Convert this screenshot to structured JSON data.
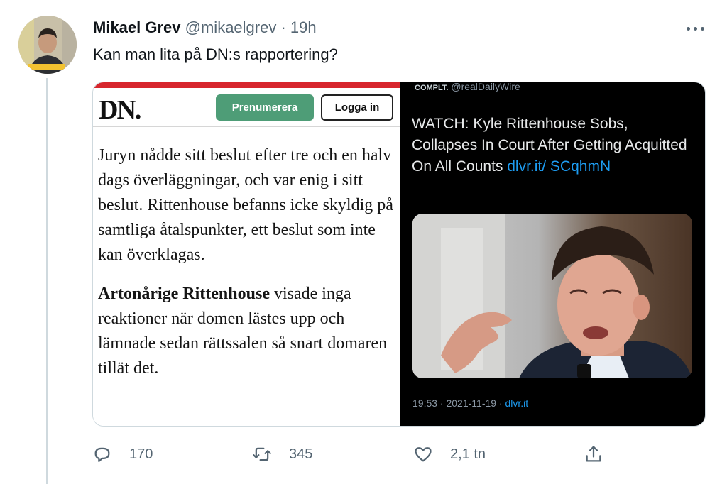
{
  "tweet": {
    "author_name": "Mikael Grev",
    "handle": "@mikaelgrev",
    "separator": "·",
    "time": "19h",
    "text": "Kan man lita på DN:s rapportering?"
  },
  "dn_panel": {
    "logo": "DN.",
    "subscribe_label": "Prenumerera",
    "login_label": "Logga in",
    "paragraph1": "Juryn nådde sitt beslut efter tre och en halv dags överläggningar, och var enig i sitt beslut. Rittenhouse befanns icke skyldig på samtliga åtalspunkter, ett beslut som inte kan överklagas.",
    "paragraph2_bold": "Artonårige Rittenhouse",
    "paragraph2_rest": " visade inga reaktioner när domen lästes upp och lämnade sedan rättssalen så snart domaren tillät det."
  },
  "dailywire_panel": {
    "brand_text": "COMPLT.",
    "handle": "@realDailyWire",
    "text": "WATCH: Kyle Rittenhouse Sobs, Collapses In Court After Getting Acquitted On All Counts ",
    "link": "dlvr.it/ SCqhmN",
    "meta_time": "19:53 · 2021-11-19 · ",
    "meta_source": "dlvr.it"
  },
  "actions": {
    "reply_count": "170",
    "retweet_count": "345",
    "like_count": "2,1 tn"
  },
  "icons": {
    "reply": "reply-icon",
    "retweet": "retweet-icon",
    "like": "heart-icon",
    "share": "share-icon",
    "more": "more-icon"
  },
  "colors": {
    "accent_link": "#1d9bf0",
    "dn_red": "#d7262d",
    "subscribe_green": "#4e9d77",
    "secondary_text": "#536471"
  }
}
